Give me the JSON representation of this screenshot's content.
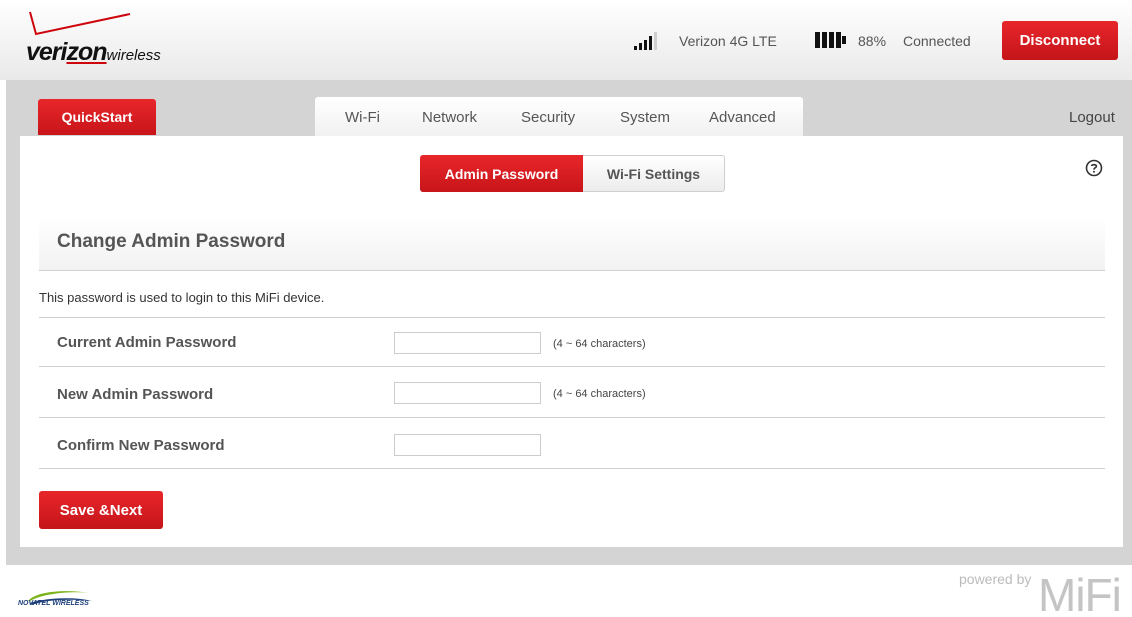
{
  "brand": {
    "logo_main": "veri",
    "logo_z": "zon",
    "logo_sub": "wireless"
  },
  "status": {
    "signal_icon": "signal-bars-icon",
    "carrier": "Verizon 4G LTE",
    "battery_icon": "battery-icon",
    "battery_percent": "88%",
    "connection": "Connected",
    "disconnect_label": "Disconnect"
  },
  "nav": {
    "quickstart": "QuickStart",
    "tabs": [
      "Wi-Fi",
      "Network",
      "Security",
      "System",
      "Advanced"
    ],
    "logout": "Logout"
  },
  "subtabs": {
    "active": "Admin Password",
    "other": "Wi-Fi Settings"
  },
  "help_icon": "help-circle-icon",
  "section": {
    "title": "Change Admin Password",
    "description": "This password is used to login to this MiFi device."
  },
  "form": {
    "rows": [
      {
        "label": "Current Admin Password",
        "value": "",
        "hint": "(4 ~ 64 characters)"
      },
      {
        "label": "New Admin Password",
        "value": "",
        "hint": "(4 ~ 64 characters)"
      },
      {
        "label": "Confirm New Password",
        "value": "",
        "hint": ""
      }
    ],
    "save_label": "Save &Next"
  },
  "footer": {
    "novatel": "NOVATEL WIRELESS",
    "powered_by": "powered by",
    "mifi": "MiFi"
  },
  "colors": {
    "accent": "#d71a1f",
    "panel": "#d4d4d4"
  }
}
